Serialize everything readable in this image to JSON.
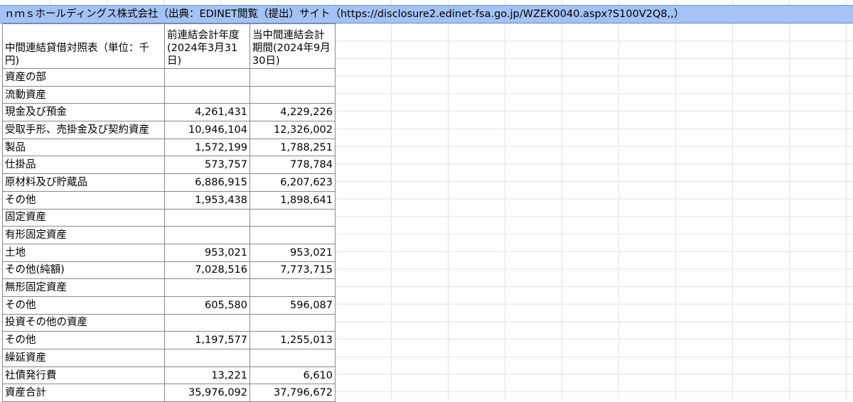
{
  "title": "ｎｍｓホールディングス株式会社（出典：EDINET閲覧（提出）サイト（https://disclosure2.edinet-fsa.go.jp/WZEK0040.aspx?S100V2Q8,,）",
  "table": {
    "headers": [
      "中間連結貸借対照表（単位：千円)",
      "前連結会計年度(2024年3月31日)",
      "当中間連結会計期間(2024年9月30日)"
    ],
    "rows": [
      {
        "label": "資産の部",
        "prev": "",
        "curr": ""
      },
      {
        "label": "流動資産",
        "prev": "",
        "curr": ""
      },
      {
        "label": "現金及び預金",
        "prev": "4,261,431",
        "curr": "4,229,226"
      },
      {
        "label": "受取手形、売掛金及び契約資産",
        "prev": "10,946,104",
        "curr": "12,326,002"
      },
      {
        "label": "製品",
        "prev": "1,572,199",
        "curr": "1,788,251"
      },
      {
        "label": "仕掛品",
        "prev": "573,757",
        "curr": "778,784"
      },
      {
        "label": "原材料及び貯蔵品",
        "prev": "6,886,915",
        "curr": "6,207,623"
      },
      {
        "label": "その他",
        "prev": "1,953,438",
        "curr": "1,898,641"
      },
      {
        "label": "固定資産",
        "prev": "",
        "curr": ""
      },
      {
        "label": "有形固定資産",
        "prev": "",
        "curr": ""
      },
      {
        "label": "土地",
        "prev": "953,021",
        "curr": "953,021"
      },
      {
        "label": "その他(純額)",
        "prev": "7,028,516",
        "curr": "7,773,715"
      },
      {
        "label": "無形固定資産",
        "prev": "",
        "curr": ""
      },
      {
        "label": "その他",
        "prev": "605,580",
        "curr": "596,087"
      },
      {
        "label": "投資その他の資産",
        "prev": "",
        "curr": ""
      },
      {
        "label": "その他",
        "prev": "1,197,577",
        "curr": "1,255,013"
      },
      {
        "label": "繰延資産",
        "prev": "",
        "curr": ""
      },
      {
        "label": "社債発行費",
        "prev": "13,221",
        "curr": "6,610"
      },
      {
        "label": "資産合計",
        "prev": "35,976,092",
        "curr": "37,796,672"
      }
    ]
  }
}
